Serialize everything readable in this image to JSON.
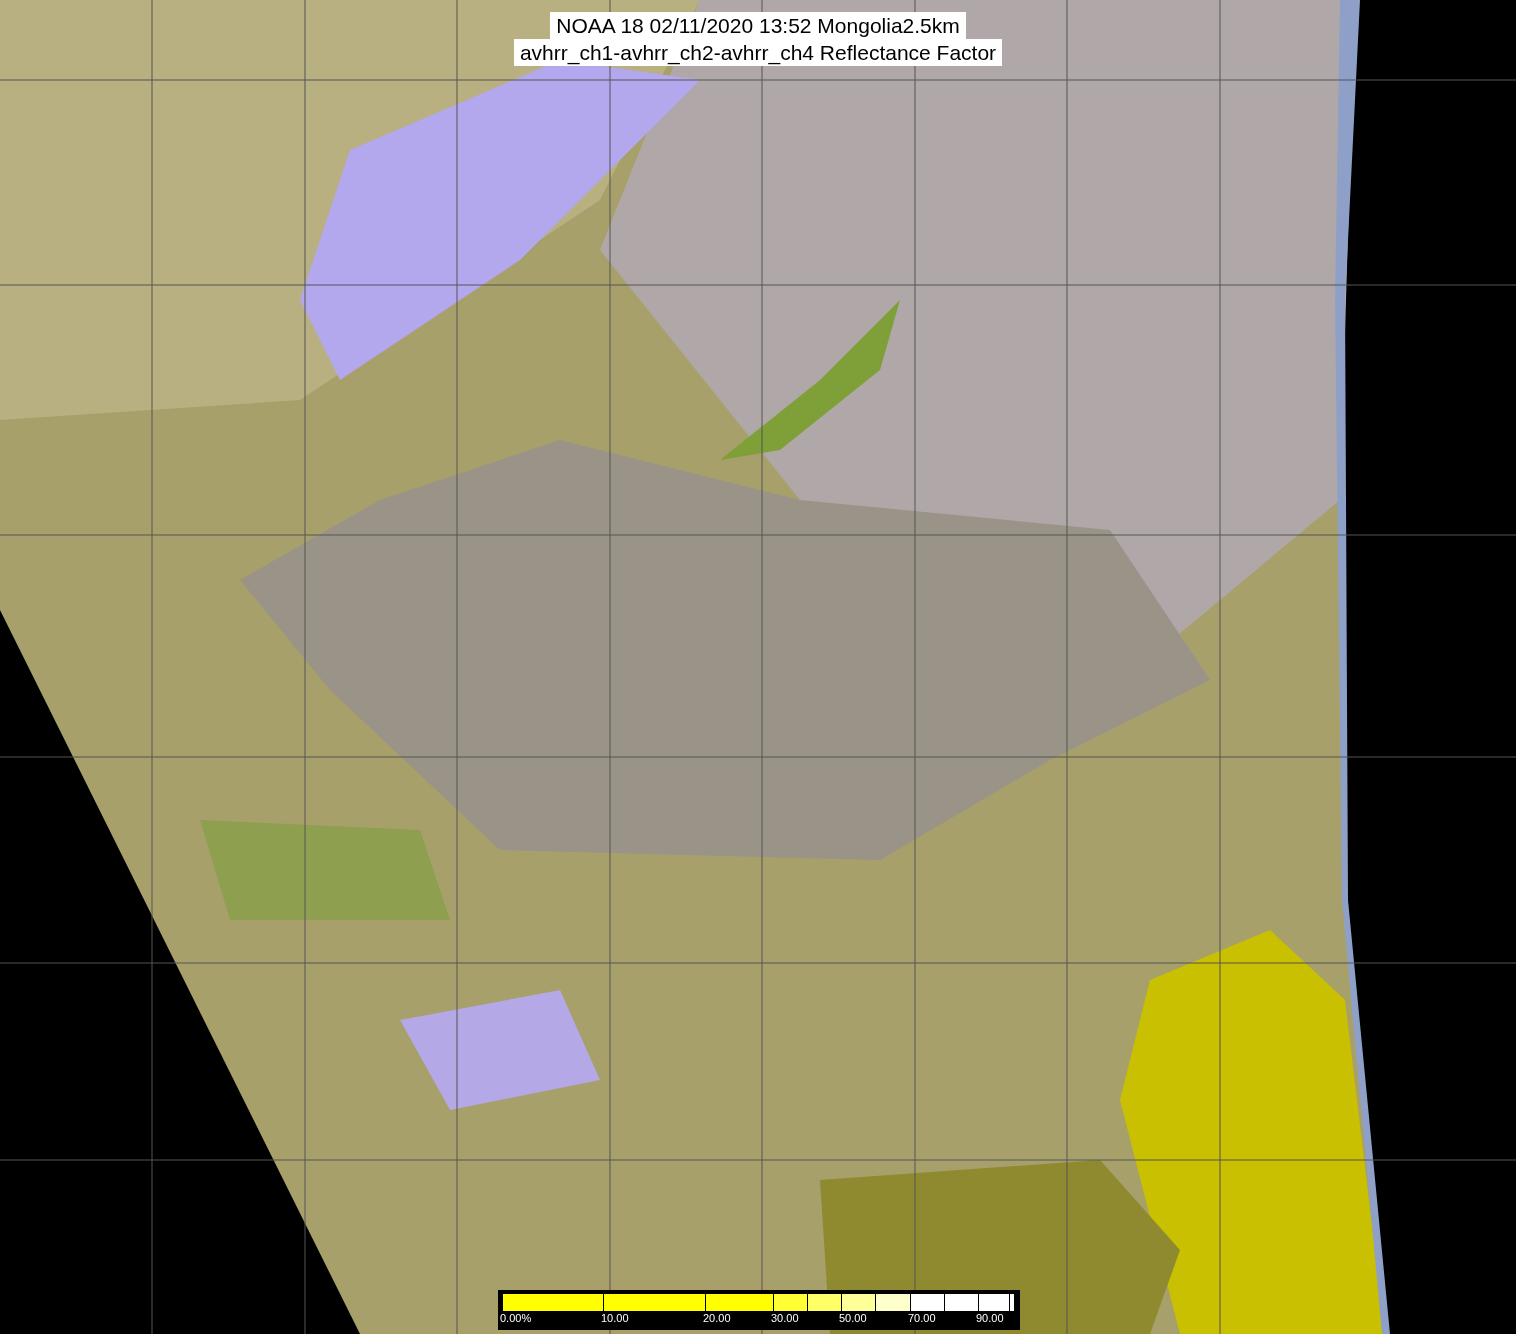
{
  "title": {
    "line_1": "NOAA 18 02/11/2020 13:52 Mongolia2.5km",
    "line_2": "avhrr_ch1-avhrr_ch2-avhrr_ch4 Reflectance Factor"
  },
  "legend": {
    "labels": [
      "0.00%",
      "10.00",
      "20.00",
      "30.00",
      "50.00",
      "70.00",
      "90.00"
    ]
  }
}
